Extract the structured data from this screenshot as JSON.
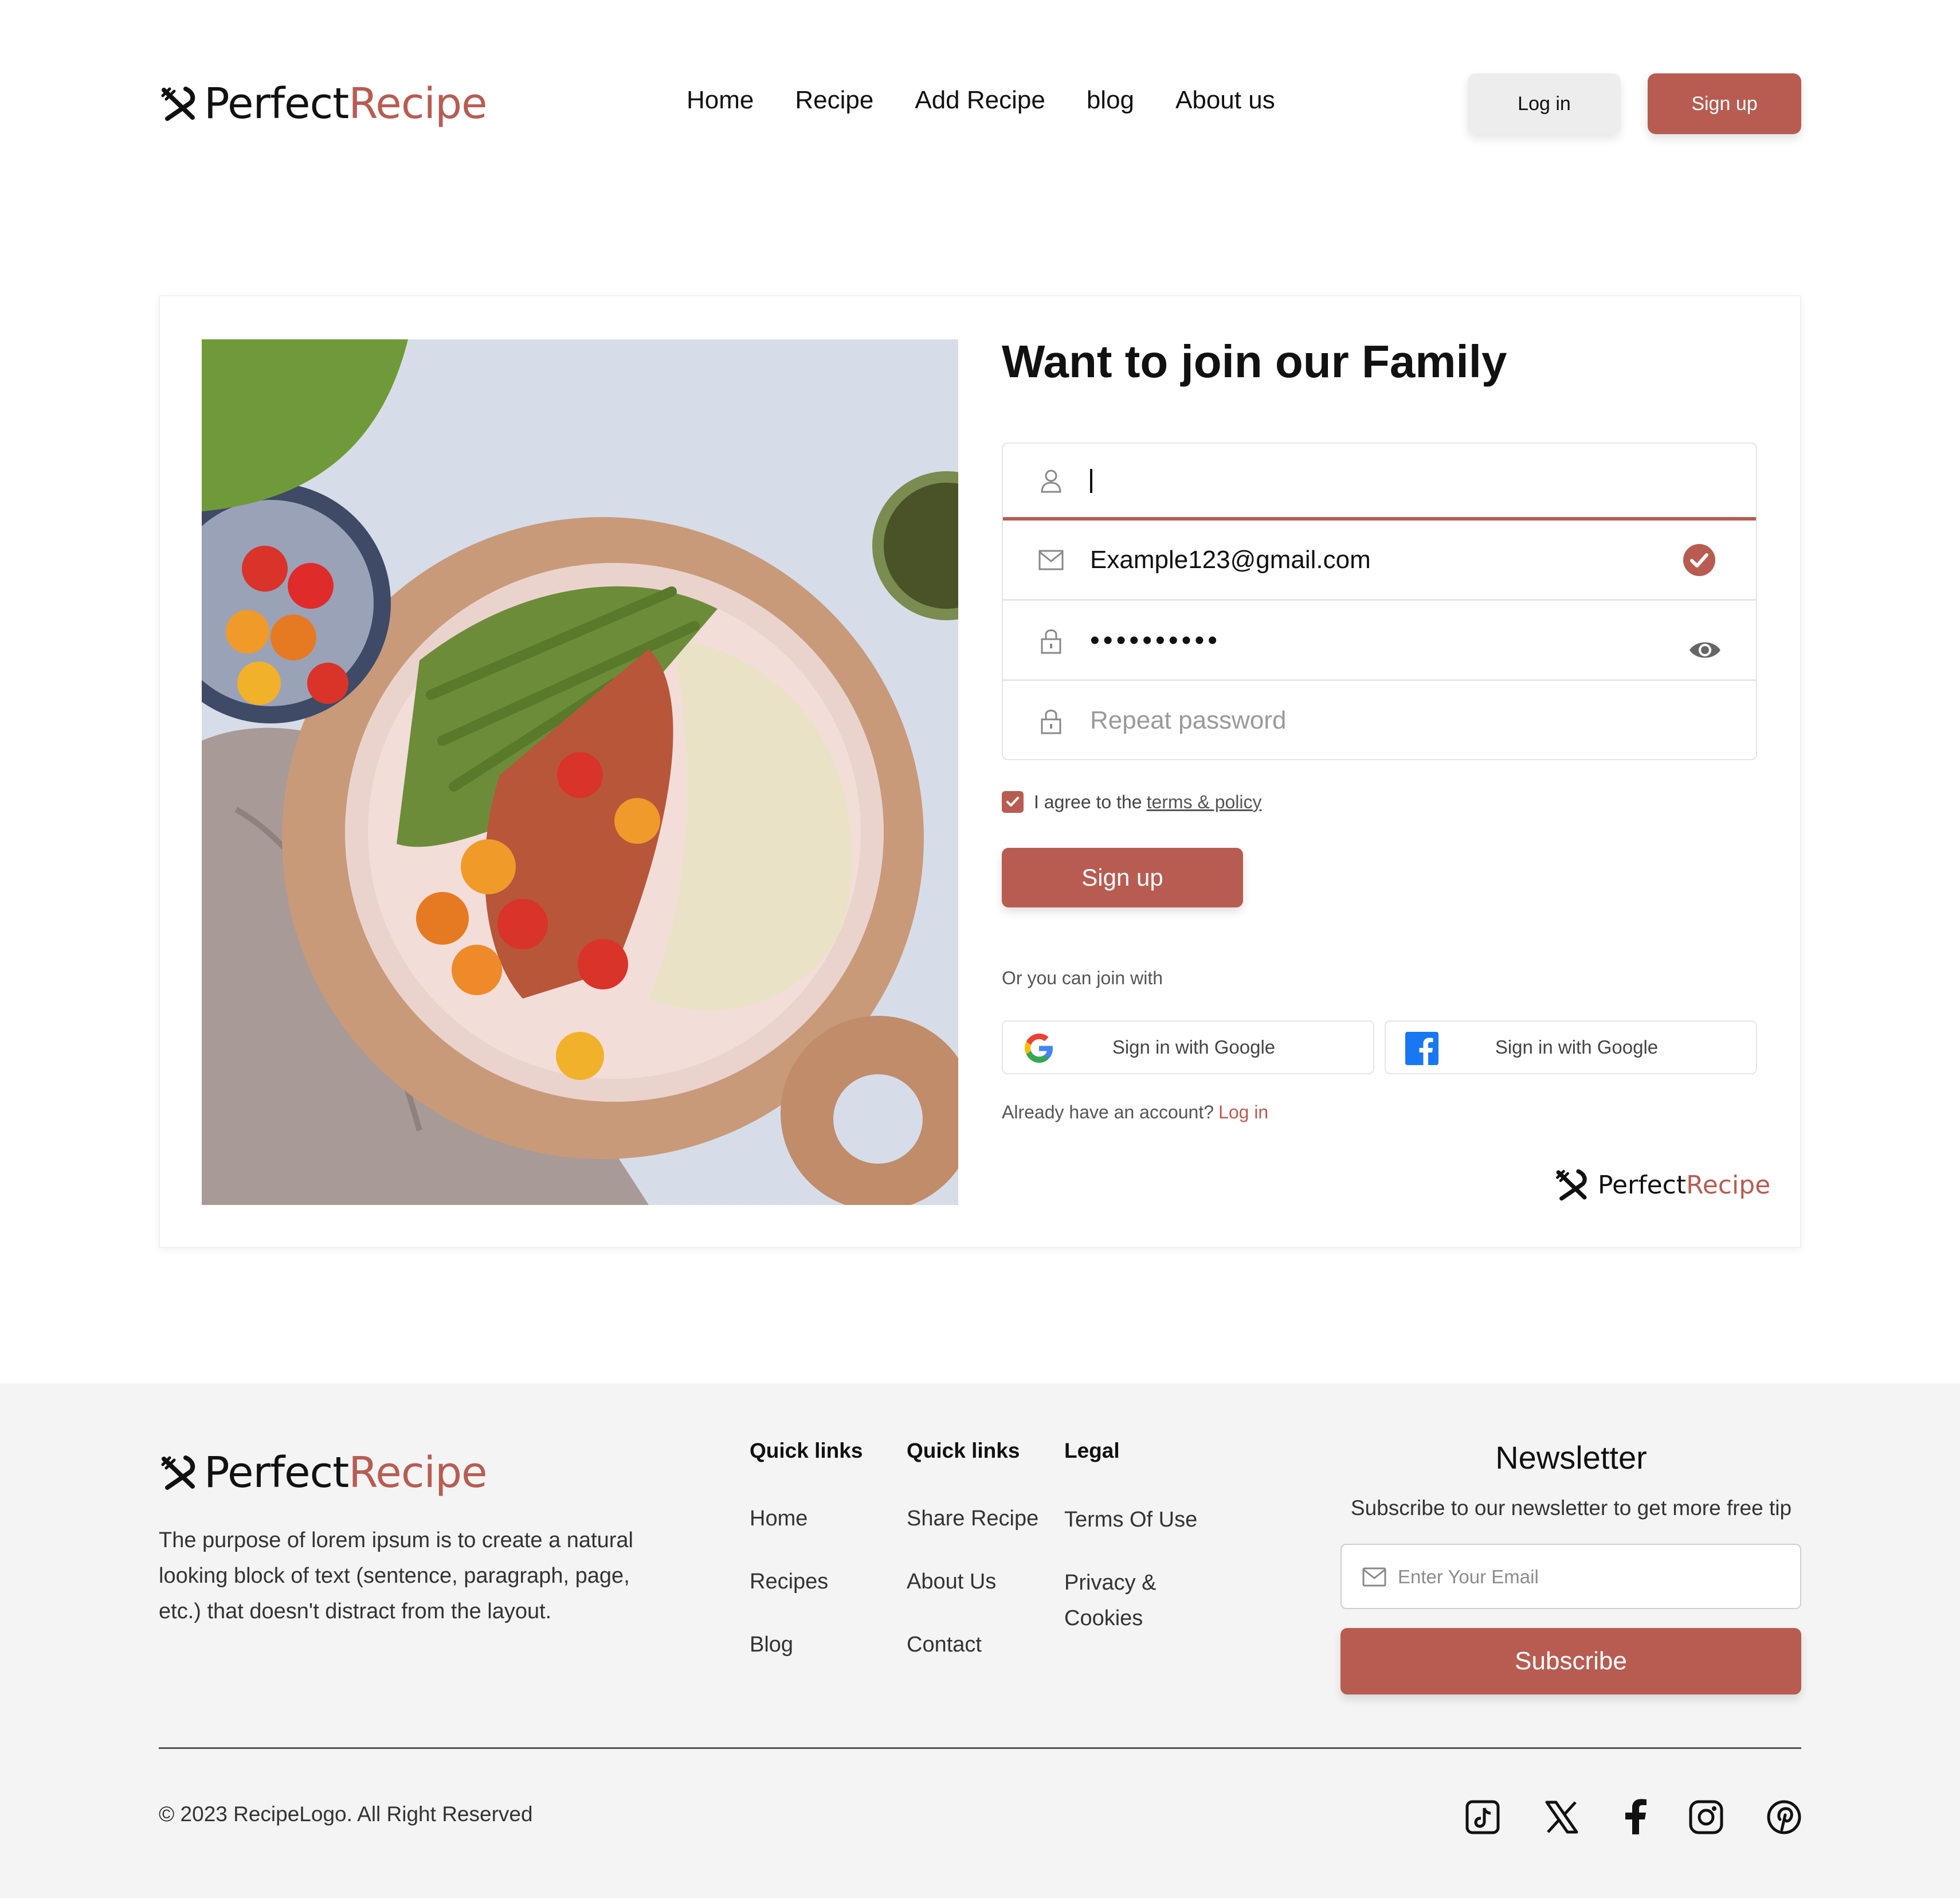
{
  "brand": {
    "name_part1": "Perfect",
    "name_part2": "Recipe",
    "accent_color": "#b85c52"
  },
  "nav": {
    "items": [
      "Home",
      "Recipe",
      "Add Recipe",
      "blog",
      "About us"
    ]
  },
  "header": {
    "login_label": "Log in",
    "signup_label": "Sign up"
  },
  "form": {
    "title": "Want to join our Family",
    "username": {
      "value": "",
      "icon": "user-icon"
    },
    "email": {
      "value": "Example123@gmail.com",
      "icon": "mail-icon",
      "status_icon": "check-circle-icon"
    },
    "password": {
      "value": "1234567890",
      "icon": "lock-icon",
      "toggle_icon": "eye-icon"
    },
    "repeat_password": {
      "placeholder": "Repeat password",
      "icon": "lock-icon"
    },
    "agree_text": "I agree to the",
    "terms_link": "terms & policy",
    "agree_checked": true,
    "submit_label": "Sign up",
    "or_text": "Or you can join with",
    "social": [
      {
        "label": "Sign in with Google",
        "icon": "google-icon"
      },
      {
        "label": "Sign in with Google",
        "icon": "facebook-icon"
      }
    ],
    "have_account_text": "Already have an account?",
    "login_link": "Log in"
  },
  "footer": {
    "description": "The purpose of lorem ipsum is to create a natural looking block of text (sentence, paragraph, page, etc.) that doesn't distract from the layout.",
    "columns": [
      {
        "heading": "Quick links",
        "links": [
          "Home",
          "Recipes",
          "Blog"
        ]
      },
      {
        "heading": "Quick links",
        "links": [
          "Share Recipe",
          "About Us",
          "Contact"
        ]
      },
      {
        "heading": "Legal",
        "links": [
          "Terms Of Use",
          "Privacy & Cookies"
        ]
      }
    ],
    "newsletter": {
      "title": "Newsletter",
      "subtitle": "Subscribe to our newsletter to get more free tip",
      "placeholder": "Enter Your Email",
      "button_label": "Subscribe"
    },
    "copyright": "© 2023 RecipeLogo. All Right Reserved",
    "social_icons": [
      "tiktok-icon",
      "x-icon",
      "facebook-icon",
      "instagram-icon",
      "pinterest-icon"
    ]
  }
}
